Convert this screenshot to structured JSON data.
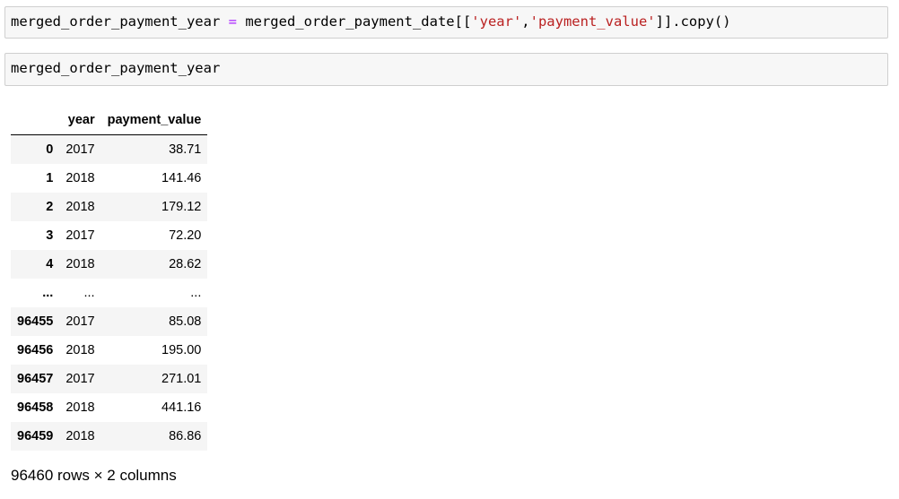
{
  "cells": [
    {
      "code_parts": [
        "merged_order_payment_year ",
        "=",
        " merged_order_payment_date[[",
        "'year'",
        ",",
        "'payment_value'",
        "]].copy()"
      ]
    },
    {
      "code": "merged_order_payment_year"
    }
  ],
  "dataframe": {
    "columns": [
      "",
      "year",
      "payment_value"
    ],
    "rows": [
      {
        "index": "0",
        "year": "2017",
        "payment_value": "38.71"
      },
      {
        "index": "1",
        "year": "2018",
        "payment_value": "141.46"
      },
      {
        "index": "2",
        "year": "2018",
        "payment_value": "179.12"
      },
      {
        "index": "3",
        "year": "2017",
        "payment_value": "72.20"
      },
      {
        "index": "4",
        "year": "2018",
        "payment_value": "28.62"
      },
      {
        "index": "...",
        "year": "...",
        "payment_value": "..."
      },
      {
        "index": "96455",
        "year": "2017",
        "payment_value": "85.08"
      },
      {
        "index": "96456",
        "year": "2018",
        "payment_value": "195.00"
      },
      {
        "index": "96457",
        "year": "2017",
        "payment_value": "271.01"
      },
      {
        "index": "96458",
        "year": "2018",
        "payment_value": "441.16"
      },
      {
        "index": "96459",
        "year": "2018",
        "payment_value": "86.86"
      }
    ],
    "shape_text": "96460 rows × 2 columns"
  },
  "colors": {
    "cell_background": "#f7f7f7",
    "cell_border": "#cfcfcf",
    "operator": "#aa22ff",
    "string": "#ba2121",
    "row_stripe": "#f5f5f5"
  }
}
